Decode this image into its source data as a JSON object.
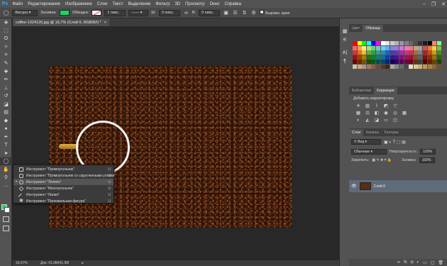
{
  "app_logo": "Ps",
  "menu": [
    "Файл",
    "Редактирование",
    "Изображение",
    "Слои",
    "Текст",
    "Выделение",
    "Фильтр",
    "3D",
    "Просмотр",
    "Окно",
    "Справка"
  ],
  "window_controls": {
    "minimize": "–",
    "restore": "❐",
    "close": "✕"
  },
  "options_bar": {
    "mode": "Фигура",
    "fill_label": "Заливка:",
    "fill_color": "#1dd36a",
    "stroke_label": "Обводка:",
    "stroke_width": "1 пикс.",
    "w_label": "Ш:",
    "w_value": "0 пикс.",
    "link_icon": "link-icon",
    "h_label": "В:",
    "h_value": "0 пикс.",
    "align_edges": "Выровн. края"
  },
  "document_tab": {
    "title": "coffee-1324126.jpg @ 16,7% (Слой 0, RGB/8#) *",
    "close": "×"
  },
  "status_bar": {
    "zoom": "16,67%",
    "doc_info": "Док: 41,9М/41,9М"
  },
  "flyout": {
    "items": [
      {
        "label": "Инструмент \"Прямоугольник\"",
        "key": "U",
        "icon": "rectangle-icon",
        "selected": false
      },
      {
        "label": "Инструмент \"Прямоугольник со скругленными углами\"",
        "key": "U",
        "icon": "rounded-rectangle-icon",
        "selected": false
      },
      {
        "label": "Инструмент \"Эллипс\"",
        "key": "U",
        "icon": "ellipse-icon",
        "selected": true
      },
      {
        "label": "Инструмент \"Многоугольник\"",
        "key": "U",
        "icon": "polygon-icon",
        "selected": false
      },
      {
        "label": "Инструмент \"Линия\"",
        "key": "U",
        "icon": "line-icon",
        "selected": false
      },
      {
        "label": "Инструмент \"Произвольная фигура\"",
        "key": "U",
        "icon": "custom-shape-icon",
        "selected": false
      }
    ]
  },
  "swatches_panel": {
    "tabs": [
      "Цвет",
      "Образцы"
    ],
    "active": "Образцы"
  },
  "adjustments_panel": {
    "tabs": [
      "Библиотеки",
      "Коррекция"
    ],
    "active": "Коррекция",
    "subtitle": "Добавить корректировку"
  },
  "layers_panel": {
    "tabs": [
      "Слои",
      "Каналы",
      "Контуры"
    ],
    "active": "Слои",
    "filter": "Вид",
    "blend_mode": "Обычные",
    "opacity_label": "Непрозрачность:",
    "opacity_value": "100%",
    "lock_label": "Закрепить:",
    "fill_label": "Заливка:",
    "fill_value": "100%",
    "layer_name": "Слой 0"
  },
  "colors": {
    "foreground": "#1dd36a",
    "background": "#ffffff",
    "swatches": [
      "#ff0000",
      "#ffff00",
      "#00ff00",
      "#00ffff",
      "#0000ff",
      "#ff00ff",
      "#ffffff",
      "#e6e6e6",
      "#cccccc",
      "#b3b3b3",
      "#999999",
      "#808080",
      "#666666",
      "#4d4d4d",
      "#333333",
      "#1a1a1a",
      "#000000",
      "#ff8080",
      "#80ff80",
      "#f26b6b",
      "#f5a05a",
      "#fff07a",
      "#b0e07a",
      "#6ed07a",
      "#6ed0b0",
      "#6ad0e8",
      "#6aa8e8",
      "#7a88d8",
      "#9a7ad8",
      "#c87ad8",
      "#e87ab8",
      "#e87a8a",
      "#c8a07a",
      "#a0a0a0",
      "#d05050",
      "#e08040",
      "#f0d040",
      "#80c040",
      "#e03030",
      "#e87020",
      "#f0c020",
      "#60b030",
      "#30a050",
      "#30a090",
      "#2090c0",
      "#2060c0",
      "#4040b0",
      "#7030b0",
      "#a030a0",
      "#d03080",
      "#d03050",
      "#a07040",
      "#808080",
      "#b02020",
      "#c05010",
      "#d0a010",
      "#409020",
      "#a01010",
      "#a04000",
      "#a08000",
      "#307010",
      "#108030",
      "#108070",
      "#1070a0",
      "#1040a0",
      "#202090",
      "#501090",
      "#801080",
      "#a01060",
      "#a01030",
      "#805020",
      "#606060",
      "#801010",
      "#903000",
      "#a07000",
      "#306010",
      "#700000",
      "#702800",
      "#705800",
      "#204800",
      "#005820",
      "#005050",
      "#004870",
      "#002870",
      "#100060",
      "#380060",
      "#580058",
      "#700040",
      "#700020",
      "#603010",
      "#404040",
      "#500000",
      "#602000",
      "#604800",
      "#204000",
      "#d8c0a8",
      "#c8a888",
      "#b89070",
      "#a07858",
      "#886048",
      "#704838",
      "#583828",
      "#402818",
      "#a8a8a8",
      "#888888",
      "#686868",
      "#484848",
      "#f0e0c0",
      "#e0c890",
      "#d0b070",
      "#c09850",
      "#a88040",
      "#906830",
      "#785020"
    ]
  }
}
